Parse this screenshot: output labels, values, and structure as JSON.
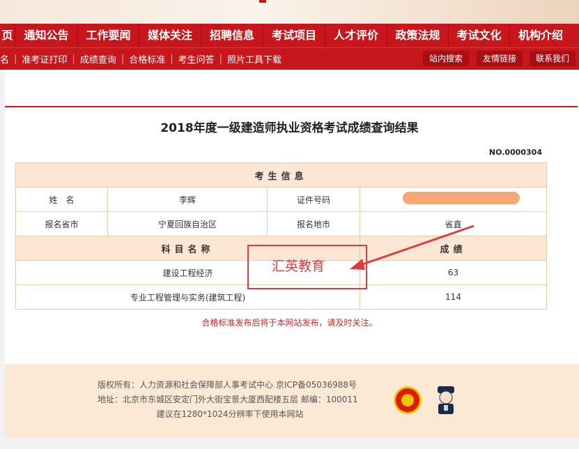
{
  "nav": {
    "items": [
      "页",
      "通知公告",
      "工作要闻",
      "媒体关注",
      "招聘信息",
      "考试项目",
      "人才评价",
      "政策法规",
      "考试文化",
      "机构介绍"
    ]
  },
  "subnav": {
    "links": [
      "名",
      "准考证打印",
      "成绩查询",
      "合格标准",
      "考生问答",
      "照片工具下载"
    ],
    "buttons": [
      "站内搜索",
      "友情链接",
      "联系我们"
    ]
  },
  "page": {
    "title": "2018年度一级建造师执业资格考试成绩查询结果",
    "number": "NO.0000304"
  },
  "table": {
    "section_header": "考生信息",
    "name_label": "姓　名",
    "name_value": "李辉",
    "id_label": "证件号码",
    "id_value": "",
    "province_label": "报名省市",
    "province_value": "宁夏回族自治区",
    "city_label": "报名地市",
    "city_value": "省直",
    "subject_header": "科目名称",
    "score_header": "成绩",
    "rows": [
      {
        "subject": "建设工程经济",
        "score": "63"
      },
      {
        "subject": "专业工程管理与实务(建筑工程)",
        "score": "114"
      }
    ]
  },
  "stamp": {
    "text": "汇英教育"
  },
  "notice": "合格标准发布后将于本网站发布，请及时关注。",
  "footer": {
    "copyright": "版权所有：人力资源和社会保障部人事考试中心 京ICP备05036988号",
    "address": "地址：北京市东城区安定门外大街宝景大厦西配楼五层 邮编：100011",
    "resolution": "建议在1280*1024分辨率下使用本网站"
  },
  "colors": {
    "brand_red": "#c8161d",
    "header_bg": "#fbe7d3",
    "stamp_red": "#e23b3b"
  }
}
